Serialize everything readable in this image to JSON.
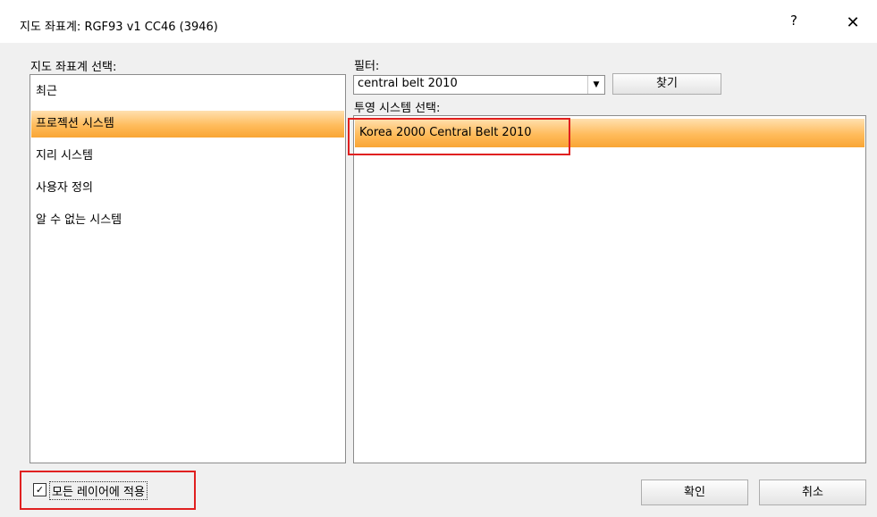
{
  "window": {
    "title": "지도 좌표계: RGF93 v1 CC46 (3946)",
    "help_label": "?",
    "close_label": "✕"
  },
  "left_panel": {
    "label": "지도 좌표계 선택:",
    "items": [
      {
        "label": "최근"
      },
      {
        "label": "프로젝션 시스템",
        "selected": true
      },
      {
        "label": "지리 시스템"
      },
      {
        "label": "사용자 정의"
      },
      {
        "label": "알 수 없는 시스템"
      }
    ]
  },
  "filter": {
    "label": "필터:",
    "value": "central belt 2010",
    "find_button": "찾기"
  },
  "projection_list": {
    "label": "투영 시스템 선택:",
    "items": [
      {
        "label": "Korea 2000 Central Belt 2010",
        "selected": true
      }
    ]
  },
  "apply_all": {
    "checked": true,
    "check_glyph": "✓",
    "label": "모든 레이어에 적용"
  },
  "buttons": {
    "ok": "확인",
    "cancel": "취소"
  },
  "colors": {
    "highlight_box": "#e02020",
    "selection": "#ffbc5c"
  },
  "icons": [
    "help-icon",
    "close-icon",
    "dropdown-arrow-icon",
    "checkmark-icon"
  ]
}
